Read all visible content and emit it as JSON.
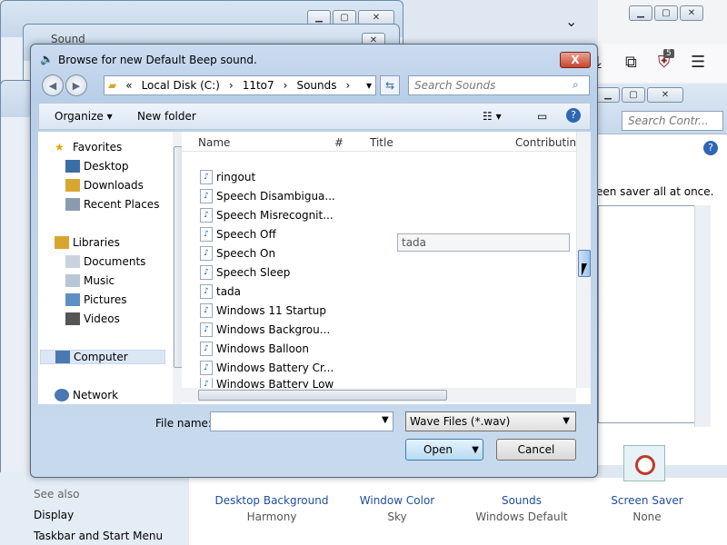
{
  "dialog": {
    "title": "Browse for new Default Beep sound.",
    "close_label": "X",
    "address": {
      "segments": [
        "Local Disk (C:)",
        "11to7",
        "Sounds"
      ],
      "sep": "›"
    },
    "search_placeholder": "Search Sounds",
    "toolbar": {
      "organize": "Organize ▾",
      "new_folder": "New folder"
    },
    "nav": {
      "favorites": "Favorites",
      "desktop": "Desktop",
      "downloads": "Downloads",
      "recent": "Recent Places",
      "libraries": "Libraries",
      "documents": "Documents",
      "music": "Music",
      "pictures": "Pictures",
      "videos": "Videos",
      "computer": "Computer",
      "network": "Network"
    },
    "columns": {
      "name": "Name",
      "num": "#",
      "title": "Title",
      "contrib": "Contributing"
    },
    "files": [
      "ringout",
      "Speech Disambigua...",
      "Speech Misrecognit...",
      "Speech Off",
      "Speech On",
      "Speech Sleep",
      "tada",
      "Windows 11 Startup",
      "Windows Backgrou...",
      "Windows Balloon",
      "Windows Battery Cr...",
      "Windows Battery Low"
    ],
    "tooltip": "tada",
    "file_name_label": "File name:",
    "file_name_value": "",
    "file_type": "Wave Files (*.wav)",
    "open_label": "Open",
    "cancel_label": "Cancel"
  },
  "background": {
    "sound_window_title": "Sound",
    "cp_search_placeholder": "Search Contr...",
    "cp_text": "een saver all at once.",
    "badge_count": "5"
  },
  "see_also": {
    "heading": "See also",
    "items": [
      "Display",
      "Taskbar and Start Menu"
    ]
  },
  "bottom_items": [
    {
      "label": "Desktop Background",
      "sub": "Harmony"
    },
    {
      "label": "Window Color",
      "sub": "Sky"
    },
    {
      "label": "Sounds",
      "sub": "Windows Default"
    },
    {
      "label": "Screen Saver",
      "sub": "None"
    }
  ],
  "colors": {
    "link": "#1e4fa0",
    "title_bg": "#c8daef",
    "close_red": "#c9432c"
  }
}
